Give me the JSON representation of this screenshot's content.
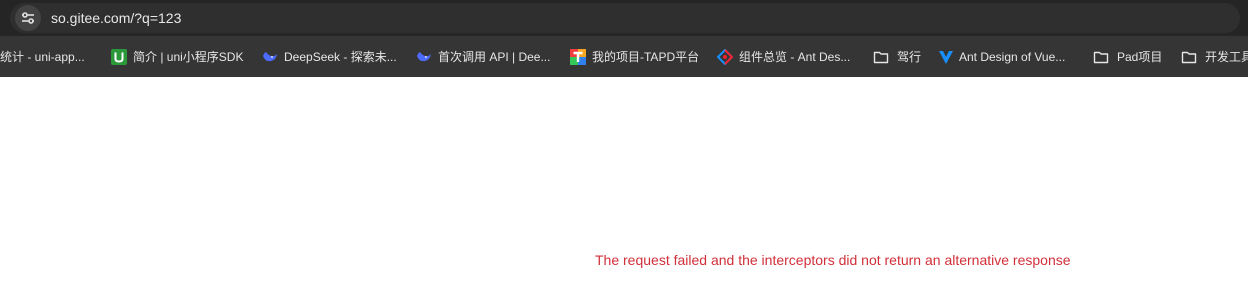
{
  "browser": {
    "url": "so.gitee.com/?q=123",
    "bookmarks": [
      {
        "label": "统计 - uni-app...",
        "icon": "none"
      },
      {
        "label": "简介 | uni小程序SDK",
        "icon": "uni-icon"
      },
      {
        "label": "DeepSeek - 探索未...",
        "icon": "deepseek-icon"
      },
      {
        "label": "首次调用 API | Dee...",
        "icon": "deepseek-icon"
      },
      {
        "label": "我的项目-TAPD平台",
        "icon": "tapd-icon"
      },
      {
        "label": "组件总览 - Ant Des...",
        "icon": "ant-design-icon"
      },
      {
        "label": "驾行",
        "icon": "folder-icon"
      },
      {
        "label": "Ant Design of Vue...",
        "icon": "ant-design-vue-icon"
      },
      {
        "label": "Pad项目",
        "icon": "folder-icon"
      },
      {
        "label": "开发工具",
        "icon": "folder-icon"
      }
    ]
  },
  "page": {
    "error_message": "The request failed and the interceptors did not return an alternative response",
    "error_color": "#d1303a"
  }
}
